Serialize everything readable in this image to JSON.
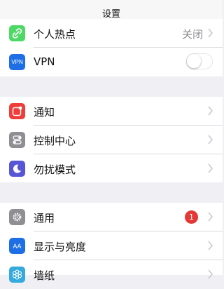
{
  "nav": {
    "title": "设置"
  },
  "groups": {
    "connectivity": {
      "hotspot": {
        "label": "个人热点",
        "value": "关闭",
        "icon": "hotspot-icon",
        "icon_color": "#4cd964"
      },
      "vpn": {
        "label": "VPN",
        "icon_text": "VPN",
        "icon": "vpn-icon",
        "icon_color": "#1e6fe6",
        "toggle_on": false
      }
    },
    "system": {
      "notifications": {
        "label": "通知",
        "icon": "notifications-icon",
        "icon_color": "#ef3e3a"
      },
      "control_center": {
        "label": "控制中心",
        "icon": "control-center-icon",
        "icon_color": "#8e8e93"
      },
      "do_not_disturb": {
        "label": "勿扰模式",
        "icon": "moon-icon",
        "icon_color": "#5856d6"
      }
    },
    "general": {
      "general": {
        "label": "通用",
        "badge": "1",
        "icon": "gear-icon",
        "icon_color": "#8e8e93"
      },
      "display": {
        "label": "显示与亮度",
        "icon_text": "AA",
        "icon": "display-brightness-icon",
        "icon_color": "#1e6fe6"
      },
      "wallpaper": {
        "label": "墙纸",
        "icon": "wallpaper-icon",
        "icon_color": "#35aadc"
      }
    }
  },
  "colors": {
    "background": "#efeff4",
    "badge": "#e53935",
    "separator": "#dcdce0"
  }
}
